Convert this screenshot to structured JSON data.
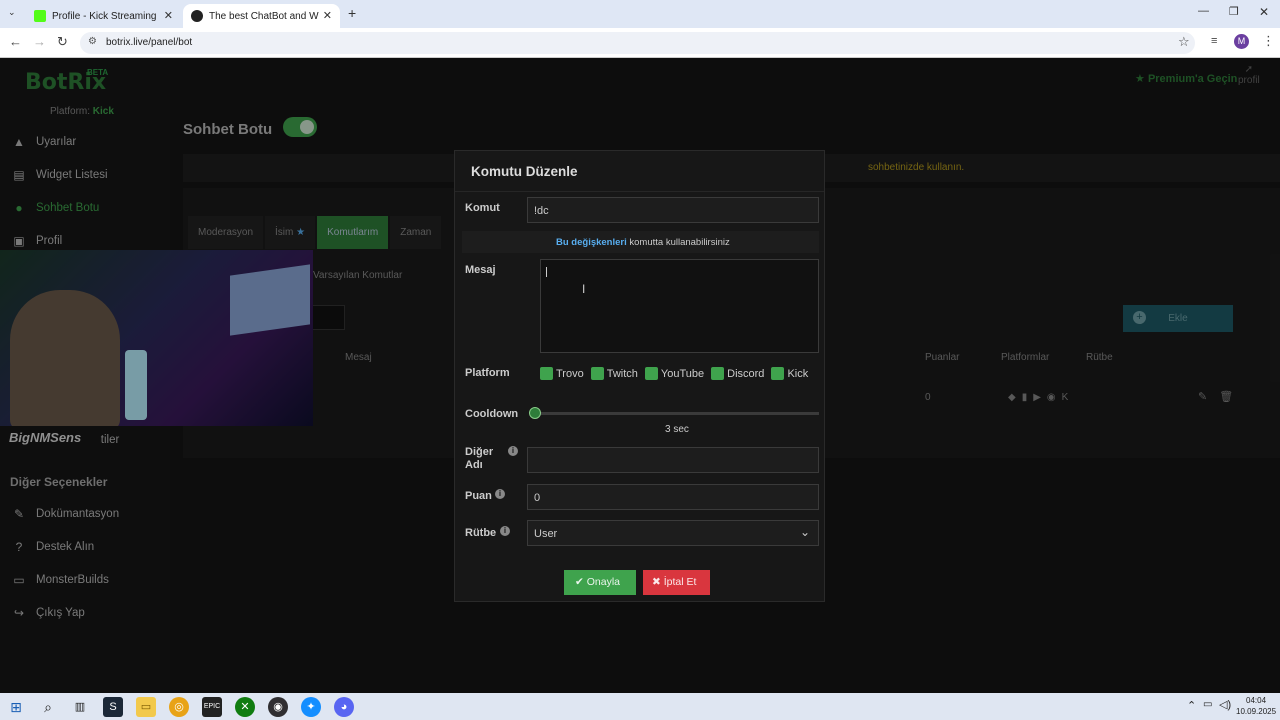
{
  "browser": {
    "tabs": [
      {
        "title": "Profile - Kick Streaming",
        "favicon_color": "#53fc18"
      },
      {
        "title": "The best ChatBot and Widgets",
        "favicon_color": "#222222"
      }
    ],
    "url": "botrix.live/panel/bot",
    "profile_initial": "M"
  },
  "sidebar": {
    "logo": "BotRix",
    "beta": "BETA",
    "platform_label": "Platform:",
    "platform_value": "Kick",
    "items": [
      {
        "label": "Uyarılar",
        "icon": "warning-icon"
      },
      {
        "label": "Widget Listesi",
        "icon": "list-icon"
      },
      {
        "label": "Sohbet Botu",
        "icon": "bot-icon"
      },
      {
        "label": "Profil",
        "icon": "profile-icon"
      },
      {
        "label": "Eklentiler",
        "icon": "plugin-icon"
      }
    ],
    "section_title": "Diğer Seçenekler",
    "other_items": [
      {
        "label": "Dokümantasyon",
        "icon": "doc-icon"
      },
      {
        "label": "Destek Alın",
        "icon": "help-icon"
      },
      {
        "label": "MonsterBuilds",
        "icon": "monitor-icon"
      },
      {
        "label": "Çıkış Yap",
        "icon": "logout-icon"
      }
    ]
  },
  "header": {
    "premium": "Premium'a Geçin",
    "profile": "profil"
  },
  "page": {
    "title": "Sohbet Botu",
    "info_text": "sohbetinizde kullanın.",
    "tabs": [
      "Moderasyon",
      "İsim",
      "Komutlarım",
      "Zaman"
    ],
    "active_tab": "Komutlarım",
    "subtab": "Varsayılan Komutlar",
    "add_button": "Ekle",
    "table_headers": [
      "Mesaj",
      "Puanlar",
      "Platformlar",
      "Rütbe"
    ],
    "row_points": "0"
  },
  "webcam": {
    "label": "BigNMSens"
  },
  "modal": {
    "title": "Komutu Düzenle",
    "command_label": "Komut",
    "command_value": "!dc",
    "hint_link": "Bu değişkenleri",
    "hint_text": " komutta kullanabilirsiniz",
    "message_label": "Mesaj",
    "message_value": "",
    "platform_label": "Platform",
    "platforms": [
      "Trovo",
      "Twitch",
      "YouTube",
      "Discord",
      "Kick"
    ],
    "cooldown_label": "Cooldown",
    "cooldown_value": "3 sec",
    "alias_label_1": "Diğer",
    "alias_label_2": "Adı",
    "alias_value": "",
    "points_label": "Puan",
    "points_value": "0",
    "rank_label": "Rütbe",
    "rank_value": "User",
    "confirm_button": "Onayla",
    "cancel_button": "İptal Et"
  },
  "taskbar": {
    "time": "04:04",
    "date": "10.09.2025"
  },
  "colors": {
    "accent_green": "#3fa34d",
    "danger_red": "#d9363e",
    "link_blue": "#58aef0"
  }
}
